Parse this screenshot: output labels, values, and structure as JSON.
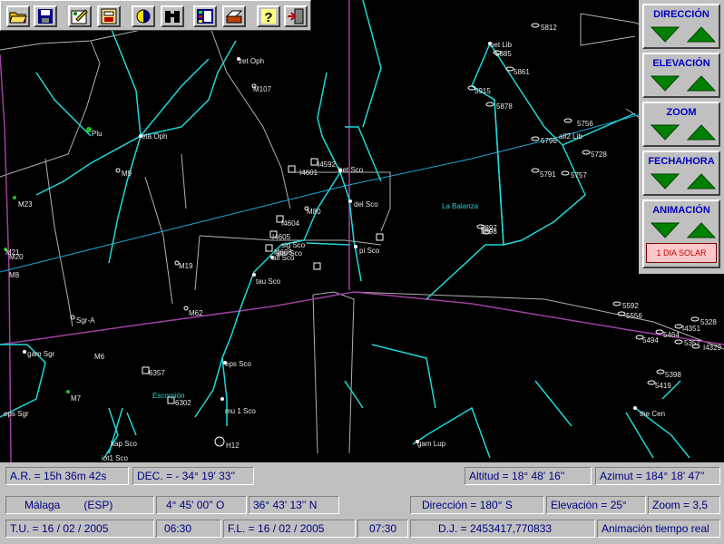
{
  "toolbar": {
    "buttons": [
      {
        "icon": "open-folder-icon"
      },
      {
        "icon": "save-disk-icon"
      },
      {
        "icon": "edit-icon"
      },
      {
        "icon": "print-icon"
      },
      {
        "icon": "moon-phase-icon"
      },
      {
        "icon": "binoculars-icon"
      },
      {
        "icon": "planets-icon"
      },
      {
        "icon": "printer-icon"
      },
      {
        "icon": "help-icon"
      },
      {
        "icon": "exit-icon"
      }
    ]
  },
  "panel": {
    "groups": [
      {
        "title": "DIRECCIÓN"
      },
      {
        "title": "ELEVACIÓN"
      },
      {
        "title": "ZOOM"
      },
      {
        "title": "FECHA/HORA"
      },
      {
        "title": "ANIMACIÓN"
      }
    ],
    "solar_button": "1 DIA SOLAR",
    "arrow_color": "#008000"
  },
  "sky": {
    "labels": [
      "zet Oph",
      "M107",
      "eta Oph",
      "Plu",
      "M9",
      "M23",
      "M21",
      "M20",
      "M8",
      "M19",
      "Sgr-A",
      "M62",
      "gam Sgr",
      "M6",
      "M7",
      "eps Sgr",
      "kap Sco",
      "iot1 Sco",
      "lam Sco",
      "6357",
      "6302",
      "eps Sco",
      "mu 1 Sco",
      "H12",
      "tau Sco",
      "alf Sco",
      "sig Sco",
      "I4605",
      "I4606",
      "I4604",
      "M80",
      "I4601",
      "I4592",
      "bet Sco",
      "del Sco",
      "pi Sco",
      "bet Lib",
      "5812",
      "5885",
      "5861",
      "5915",
      "5878",
      "5756",
      "alf2 Lib",
      "5796",
      "5728",
      "5791",
      "5757",
      "5897",
      "5898",
      "5592",
      "5556",
      "5494",
      "I4351",
      "5464",
      "5328",
      "5357",
      "I4329",
      "5398",
      "5419",
      "the Cen",
      "gam Lup"
    ],
    "constellations": [
      "La Balanza",
      "Escorpión"
    ],
    "colors": {
      "lines": "#20d8d8",
      "ecliptic": "#a040a0",
      "grid": "#b0b0b0",
      "planet": "#20c020"
    }
  },
  "status": {
    "ra": "A.R. = 15h 36m 42s",
    "dec": "DEC. = - 34° 19' 33''",
    "alt": "Altitud = 18° 48' 16''",
    "az": "Azimut = 184° 18' 47''",
    "city": "Málaga",
    "country": "(ESP)",
    "lon": "4° 45' 00'' O",
    "lat": "36° 43' 13'' N",
    "direction": "Dirección = 180° S",
    "elevation": "Elevación = 25°",
    "zoom": "Zoom = 3,5",
    "tu_date": "T.U. = 16 / 02 /  2005",
    "tu_time": "06:30",
    "fl_date": "F.L. = 16 / 02 /  2005",
    "fl_time": "07:30",
    "jd": "D.J. = 2453417,770833",
    "anim": "Animación tiempo real"
  }
}
